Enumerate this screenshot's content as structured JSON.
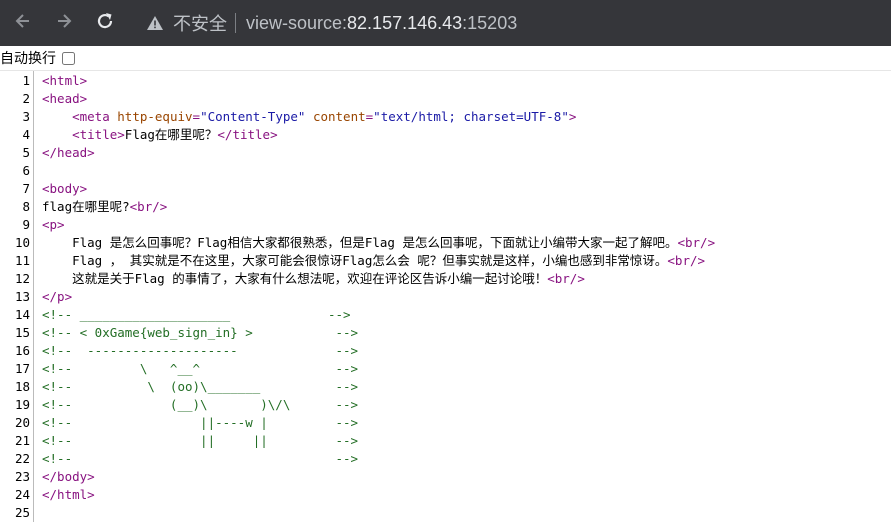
{
  "browser": {
    "security_label": "不安全",
    "url_scheme": "view-source:",
    "url_host": "82.157.146.43",
    "url_port": ":15203"
  },
  "wrap_toggle": {
    "label": "自动换行",
    "checked": false
  },
  "source": {
    "line_numbers": [
      "1",
      "2",
      "3",
      "4",
      "5",
      "6",
      "7",
      "8",
      "9",
      "10",
      "11",
      "12",
      "13",
      "14",
      "15",
      "16",
      "17",
      "18",
      "19",
      "20",
      "21",
      "22",
      "23",
      "24",
      "25"
    ],
    "lines": [
      [
        {
          "t": "tag",
          "v": "<html>"
        }
      ],
      [
        {
          "t": "tag",
          "v": "<head>"
        }
      ],
      [
        {
          "t": "txt",
          "v": "    "
        },
        {
          "t": "tag",
          "v": "<meta "
        },
        {
          "t": "attr",
          "v": "http-equiv"
        },
        {
          "t": "tag",
          "v": "="
        },
        {
          "t": "val",
          "v": "\"Content-Type\""
        },
        {
          "t": "txt",
          "v": " "
        },
        {
          "t": "attr",
          "v": "content"
        },
        {
          "t": "tag",
          "v": "="
        },
        {
          "t": "val",
          "v": "\"text/html; charset=UTF-8\""
        },
        {
          "t": "tag",
          "v": ">"
        }
      ],
      [
        {
          "t": "txt",
          "v": "    "
        },
        {
          "t": "tag",
          "v": "<title>"
        },
        {
          "t": "txt",
          "v": "Flag在哪里呢？"
        },
        {
          "t": "tag",
          "v": "</title>"
        }
      ],
      [
        {
          "t": "tag",
          "v": "</head>"
        }
      ],
      [
        {
          "t": "txt",
          "v": ""
        }
      ],
      [
        {
          "t": "tag",
          "v": "<body>"
        }
      ],
      [
        {
          "t": "txt",
          "v": "flag在哪里呢?"
        },
        {
          "t": "tag",
          "v": "<br/>"
        }
      ],
      [
        {
          "t": "tag",
          "v": "<p>"
        }
      ],
      [
        {
          "t": "txt",
          "v": "    Flag 是怎么回事呢？Flag相信大家都很熟悉，但是Flag 是怎么回事呢，下面就让小编带大家一起了解吧。"
        },
        {
          "t": "tag",
          "v": "<br/>"
        }
      ],
      [
        {
          "t": "txt",
          "v": "    Flag ， 其实就是不在这里，大家可能会很惊讶Flag怎么会 呢？但事实就是这样，小编也感到非常惊讶。"
        },
        {
          "t": "tag",
          "v": "<br/>"
        }
      ],
      [
        {
          "t": "txt",
          "v": "    这就是关于Flag 的事情了，大家有什么想法呢，欢迎在评论区告诉小编一起讨论哦！"
        },
        {
          "t": "tag",
          "v": "<br/>"
        }
      ],
      [
        {
          "t": "tag",
          "v": "</p>"
        }
      ],
      [
        {
          "t": "cmt",
          "v": "<!-- ____________________             -->"
        }
      ],
      [
        {
          "t": "cmt",
          "v": "<!-- < 0xGame{web_sign_in} >           -->"
        }
      ],
      [
        {
          "t": "cmt",
          "v": "<!--  --------------------             -->"
        }
      ],
      [
        {
          "t": "cmt",
          "v": "<!--         \\   ^__^                  -->"
        }
      ],
      [
        {
          "t": "cmt",
          "v": "<!--          \\  (oo)\\_______          -->"
        }
      ],
      [
        {
          "t": "cmt",
          "v": "<!--             (__)\\       )\\/\\      -->"
        }
      ],
      [
        {
          "t": "cmt",
          "v": "<!--                 ||----w |         -->"
        }
      ],
      [
        {
          "t": "cmt",
          "v": "<!--                 ||     ||         -->"
        }
      ],
      [
        {
          "t": "cmt",
          "v": "<!--                                   -->"
        }
      ],
      [
        {
          "t": "tag",
          "v": "</body>"
        }
      ],
      [
        {
          "t": "tag",
          "v": "</html>"
        }
      ],
      [
        {
          "t": "txt",
          "v": ""
        }
      ]
    ]
  },
  "icons": {
    "back": "arrow-left-icon",
    "forward": "arrow-right-icon",
    "reload": "reload-icon",
    "warning": "warning-triangle-icon"
  },
  "colors": {
    "topbar": "#35363a",
    "tag": "#881280",
    "attr": "#994500",
    "value": "#1a1aa6",
    "comment": "#236e25"
  }
}
